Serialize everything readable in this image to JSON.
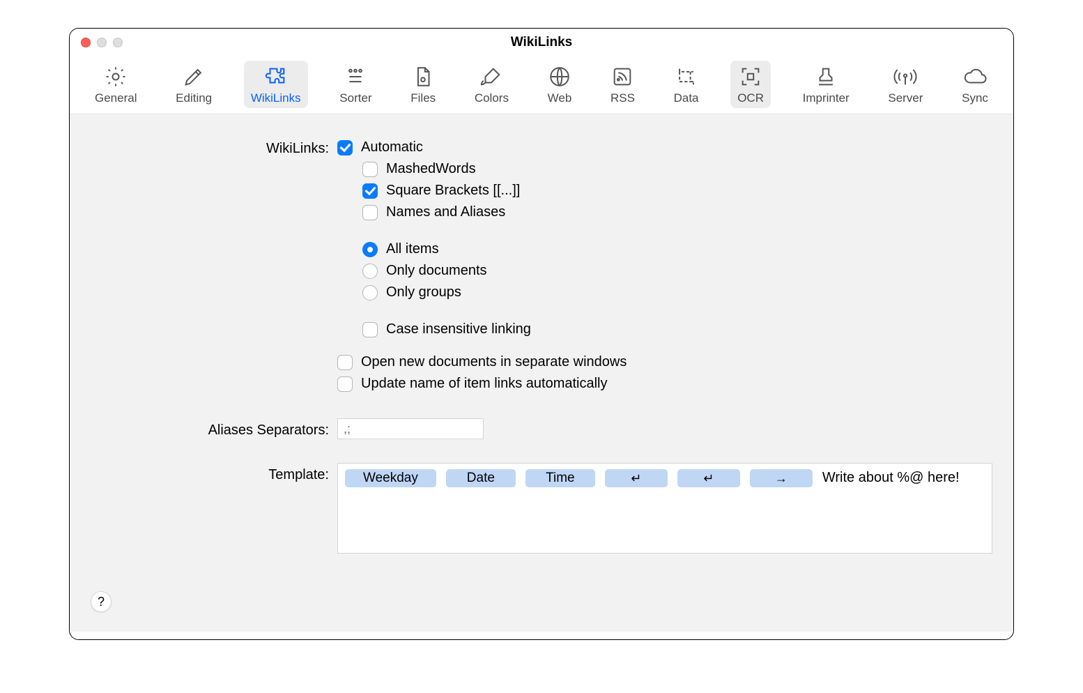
{
  "window": {
    "title": "WikiLinks"
  },
  "toolbar": {
    "items": [
      {
        "id": "general",
        "label": "General"
      },
      {
        "id": "editing",
        "label": "Editing"
      },
      {
        "id": "wikilinks",
        "label": "WikiLinks",
        "selected": true
      },
      {
        "id": "sorter",
        "label": "Sorter"
      },
      {
        "id": "files",
        "label": "Files"
      },
      {
        "id": "colors",
        "label": "Colors"
      },
      {
        "id": "web",
        "label": "Web"
      },
      {
        "id": "rss",
        "label": "RSS"
      },
      {
        "id": "data",
        "label": "Data"
      },
      {
        "id": "ocr",
        "label": "OCR",
        "hovered": true
      },
      {
        "id": "imprinter",
        "label": "Imprinter"
      },
      {
        "id": "server",
        "label": "Server"
      },
      {
        "id": "sync",
        "label": "Sync"
      }
    ]
  },
  "labels": {
    "wikilinks": "WikiLinks:",
    "aliases": "Aliases Separators:",
    "template": "Template:",
    "help": "?"
  },
  "options": {
    "automatic": "Automatic",
    "mashed": "MashedWords",
    "brackets": "Square Brackets [[...]]",
    "names_aliases": "Names and Aliases",
    "all_items": "All items",
    "only_docs": "Only documents",
    "only_groups": "Only groups",
    "case_insensitive": "Case insensitive linking",
    "open_separate": "Open new documents in separate windows",
    "update_name": "Update name of item links automatically"
  },
  "state": {
    "automatic": true,
    "mashed": false,
    "brackets": true,
    "names_aliases": false,
    "scope": "all_items",
    "case_insensitive": false,
    "open_separate": false,
    "update_name": false
  },
  "aliases_value": ",;",
  "template": {
    "tokens": [
      "Weekday",
      "Date",
      "Time",
      "↵",
      "↵",
      "→"
    ],
    "trailing_text": "Write about %@ here!"
  }
}
